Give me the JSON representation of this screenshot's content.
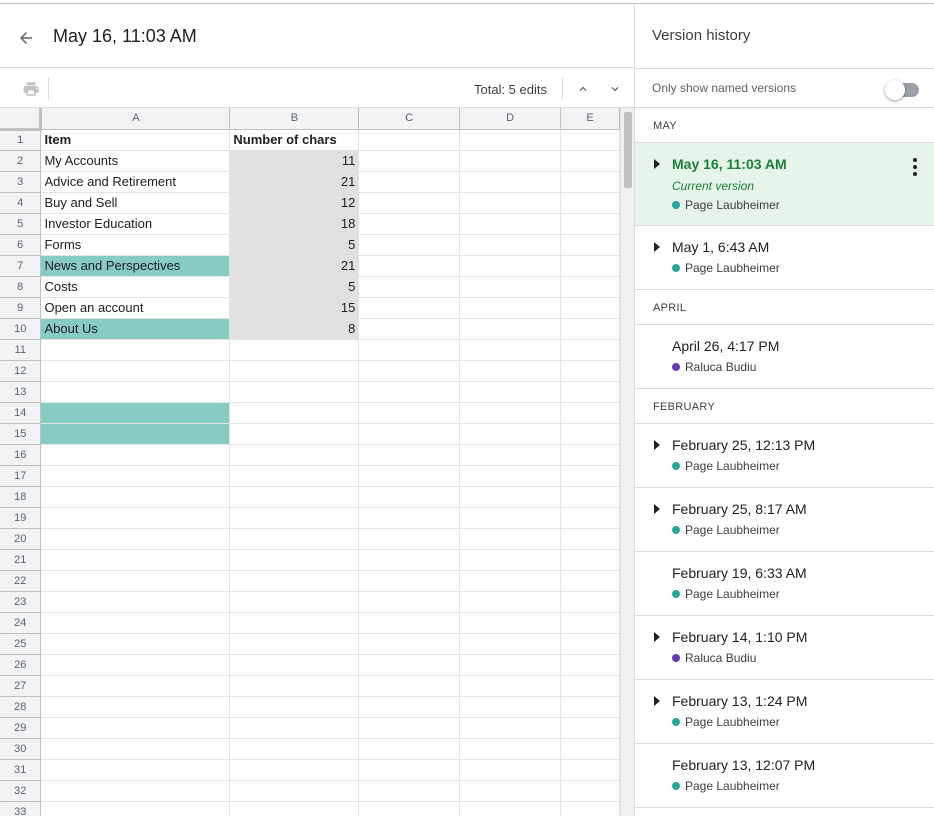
{
  "header": {
    "title": "May 16, 11:03 AM"
  },
  "toolbar": {
    "edits_label": "Total: 5 edits"
  },
  "sheet": {
    "columns": [
      "A",
      "B",
      "C",
      "D",
      "E"
    ],
    "rows": [
      {
        "n": "1",
        "a": "Item",
        "b": "Number of chars",
        "a_style": "bold",
        "b_style": "bold"
      },
      {
        "n": "2",
        "a": "My Accounts",
        "b": "11",
        "b_style": "grey"
      },
      {
        "n": "3",
        "a": "Advice and Retirement",
        "b": "21",
        "b_style": "grey"
      },
      {
        "n": "4",
        "a": "Buy and Sell",
        "b": "12",
        "b_style": "grey"
      },
      {
        "n": "5",
        "a": "Investor Education",
        "b": "18",
        "b_style": "grey"
      },
      {
        "n": "6",
        "a": "Forms",
        "b": "5",
        "b_style": "grey"
      },
      {
        "n": "7",
        "a": "News and Perspectives",
        "b": "21",
        "a_style": "teal",
        "b_style": "grey"
      },
      {
        "n": "8",
        "a": "Costs",
        "b": "5",
        "b_style": "grey"
      },
      {
        "n": "9",
        "a": "Open an account",
        "b": "15",
        "b_style": "grey"
      },
      {
        "n": "10",
        "a": "About Us",
        "b": "8",
        "a_style": "teal",
        "b_style": "grey"
      },
      {
        "n": "11",
        "a": "",
        "b": ""
      },
      {
        "n": "12",
        "a": "",
        "b": ""
      },
      {
        "n": "13",
        "a": "",
        "b": ""
      },
      {
        "n": "14",
        "a": "",
        "b": "",
        "a_style": "teal"
      },
      {
        "n": "15",
        "a": "",
        "b": "",
        "a_style": "teal"
      },
      {
        "n": "16",
        "a": "",
        "b": ""
      },
      {
        "n": "17",
        "a": "",
        "b": ""
      },
      {
        "n": "18",
        "a": "",
        "b": ""
      },
      {
        "n": "19",
        "a": "",
        "b": ""
      },
      {
        "n": "20",
        "a": "",
        "b": ""
      },
      {
        "n": "21",
        "a": "",
        "b": ""
      },
      {
        "n": "22",
        "a": "",
        "b": ""
      },
      {
        "n": "23",
        "a": "",
        "b": ""
      },
      {
        "n": "24",
        "a": "",
        "b": ""
      },
      {
        "n": "25",
        "a": "",
        "b": ""
      },
      {
        "n": "26",
        "a": "",
        "b": ""
      },
      {
        "n": "27",
        "a": "",
        "b": ""
      },
      {
        "n": "28",
        "a": "",
        "b": ""
      },
      {
        "n": "29",
        "a": "",
        "b": ""
      },
      {
        "n": "30",
        "a": "",
        "b": ""
      },
      {
        "n": "31",
        "a": "",
        "b": ""
      },
      {
        "n": "32",
        "a": "",
        "b": ""
      },
      {
        "n": "33",
        "a": "",
        "b": ""
      }
    ]
  },
  "panel": {
    "title": "Version history",
    "named_label": "Only show named versions",
    "sections": [
      {
        "label": "MAY",
        "versions": [
          {
            "date": "May 16, 11:03 AM",
            "current_label": "Current version",
            "user": "Page Laubheimer",
            "user_color": "#26a69a",
            "expandable": true,
            "current": true
          },
          {
            "date": "May 1, 6:43 AM",
            "user": "Page Laubheimer",
            "user_color": "#26a69a",
            "expandable": true
          }
        ]
      },
      {
        "label": "APRIL",
        "versions": [
          {
            "date": "April 26, 4:17 PM",
            "user": "Raluca Budiu",
            "user_color": "#673ab7",
            "expandable": false
          }
        ]
      },
      {
        "label": "FEBRUARY",
        "versions": [
          {
            "date": "February 25, 12:13 PM",
            "user": "Page Laubheimer",
            "user_color": "#26a69a",
            "expandable": true
          },
          {
            "date": "February 25, 8:17 AM",
            "user": "Page Laubheimer",
            "user_color": "#26a69a",
            "expandable": true
          },
          {
            "date": "February 19, 6:33 AM",
            "user": "Page Laubheimer",
            "user_color": "#26a69a",
            "expandable": false
          },
          {
            "date": "February 14, 1:10 PM",
            "user": "Raluca Budiu",
            "user_color": "#673ab7",
            "expandable": true
          },
          {
            "date": "February 13, 1:24 PM",
            "user": "Page Laubheimer",
            "user_color": "#26a69a",
            "expandable": true
          },
          {
            "date": "February 13, 12:07 PM",
            "user": "Page Laubheimer",
            "user_color": "#26a69a",
            "expandable": false
          }
        ]
      }
    ]
  },
  "icons": {
    "back": "arrow-left-icon",
    "print": "print-icon",
    "up": "chevron-up-icon",
    "down": "chevron-down-icon",
    "more": "more-vertical-icon"
  },
  "colors": {
    "highlight_teal": "#86cbc4",
    "highlight_grey": "#e0e0e0",
    "current_bg": "#e6f4ea",
    "current_text": "#188038"
  }
}
